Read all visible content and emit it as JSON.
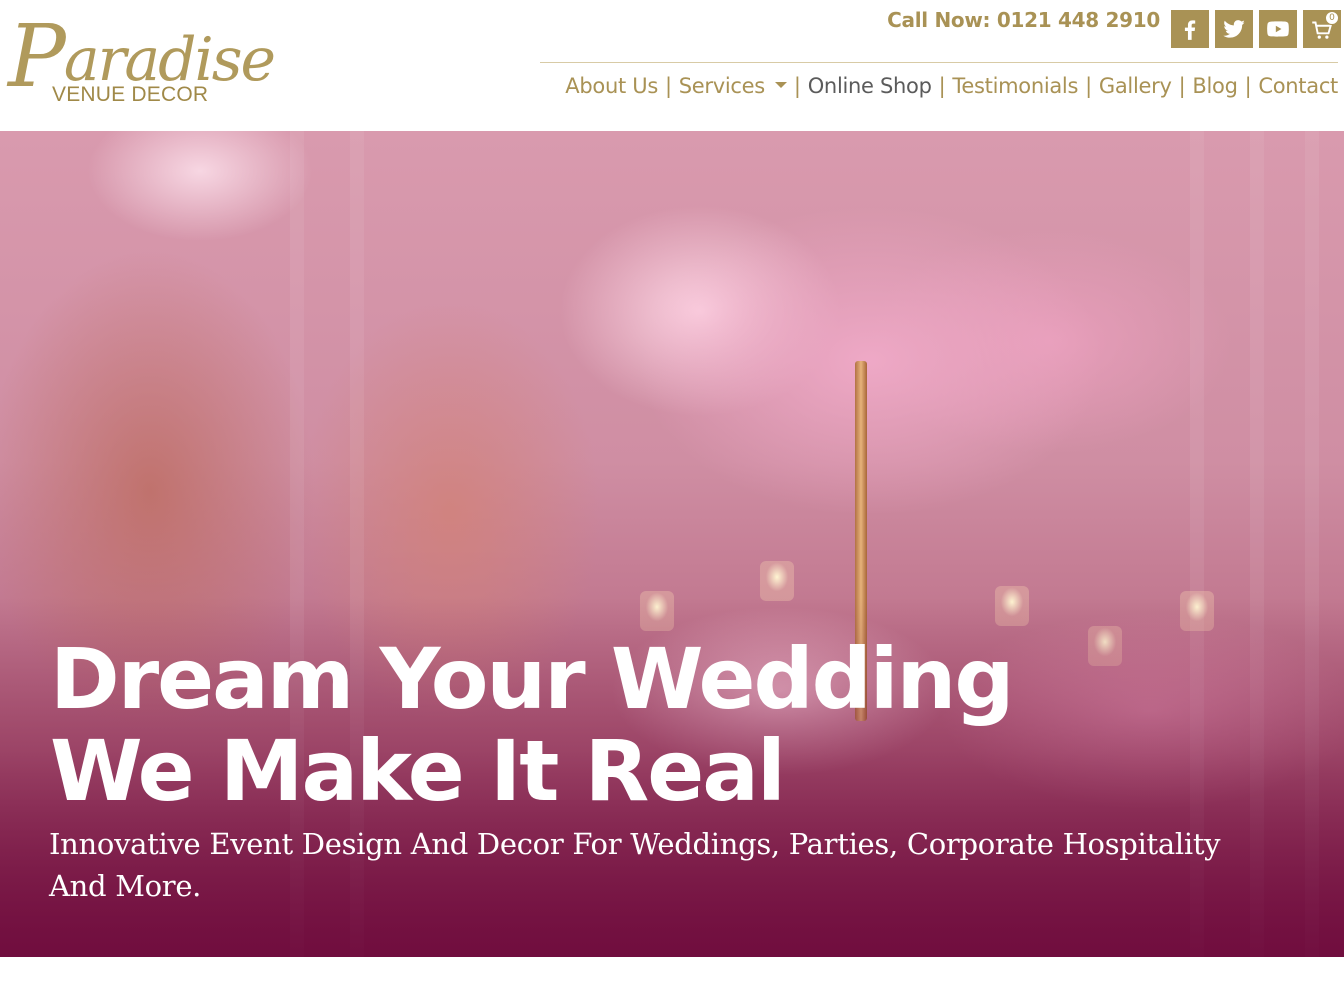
{
  "brand": {
    "logo_script": "Paradise",
    "logo_sub": "VENUE DECOR"
  },
  "header": {
    "call_now": "Call Now: 0121 448 2910",
    "social": [
      {
        "name": "facebook-icon"
      },
      {
        "name": "twitter-icon"
      },
      {
        "name": "youtube-icon"
      }
    ],
    "cart": {
      "icon": "cart-icon",
      "count": "0"
    }
  },
  "nav": {
    "items": [
      {
        "label": "About Us"
      },
      {
        "label": "Services",
        "has_dropdown": true
      },
      {
        "label": "Online Shop"
      },
      {
        "label": "Testimonials"
      },
      {
        "label": "Gallery"
      },
      {
        "label": "Blog"
      },
      {
        "label": "Contact"
      }
    ],
    "separator": "|"
  },
  "hero": {
    "title_line1": "Dream Your Wedding",
    "title_line2": "We Make It Real",
    "subtitle": "Innovative Event Design And Decor For Weddings, Parties, Corporate Hospitality And More."
  },
  "colors": {
    "gold": "#a99255",
    "nav_dark": "#5b5b5b",
    "hero_bottom": "#7e1f4a"
  }
}
